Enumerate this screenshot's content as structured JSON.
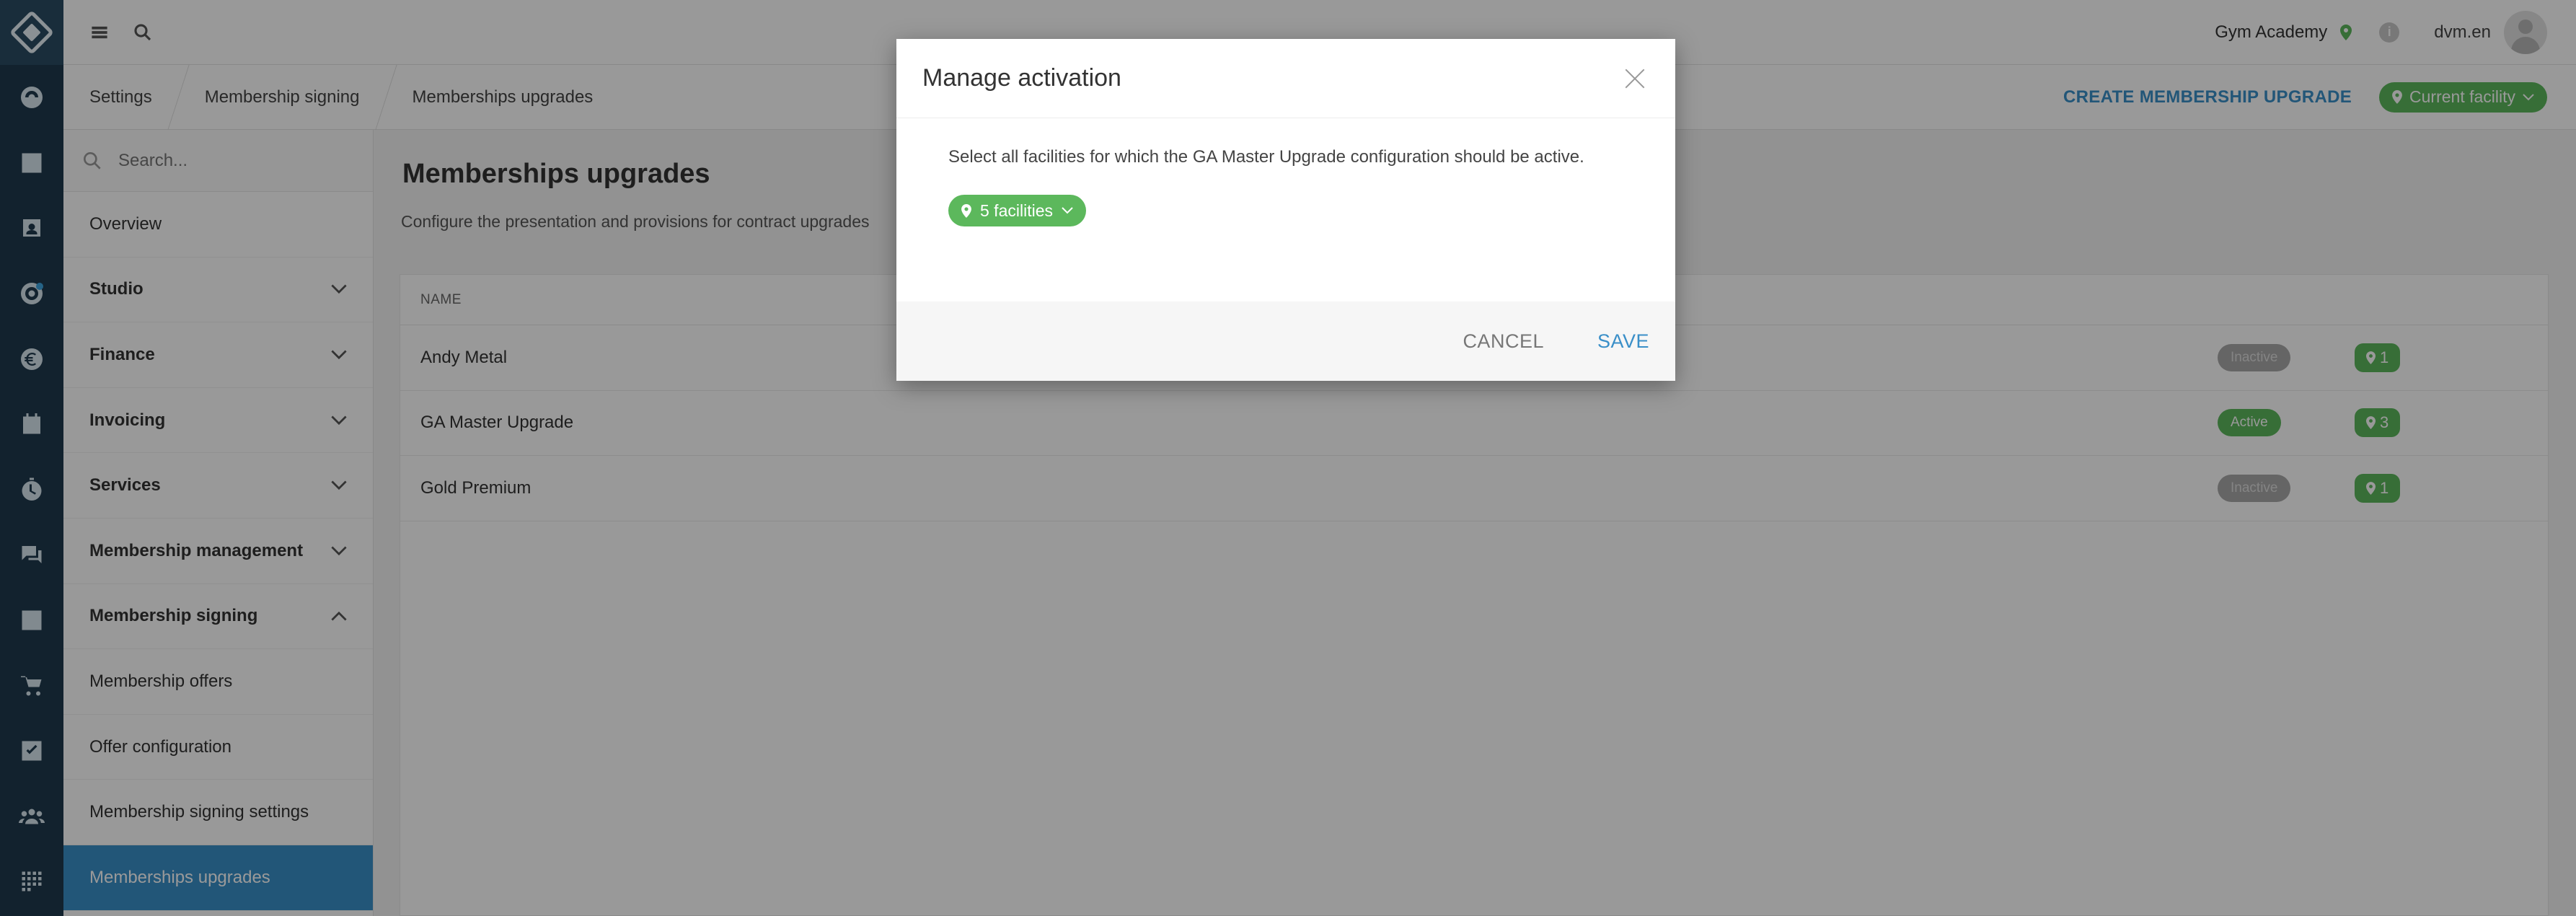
{
  "topbar": {
    "gym_name": "Gym Academy",
    "user_name": "dvm.en"
  },
  "breadcrumb": [
    "Settings",
    "Membership signing",
    "Memberships upgrades"
  ],
  "header_actions": {
    "create_label": "CREATE MEMBERSHIP UPGRADE",
    "facility_label": "Current facility"
  },
  "sidebar": {
    "search_placeholder": "Search...",
    "items": [
      {
        "label": "Overview",
        "section": false
      },
      {
        "label": "Studio",
        "section": true,
        "expanded": false
      },
      {
        "label": "Finance",
        "section": true,
        "expanded": false
      },
      {
        "label": "Invoicing",
        "section": true,
        "expanded": false
      },
      {
        "label": "Services",
        "section": true,
        "expanded": false
      },
      {
        "label": "Membership management",
        "section": true,
        "expanded": false
      },
      {
        "label": "Membership signing",
        "section": true,
        "expanded": true
      },
      {
        "label": "Membership offers",
        "section": false
      },
      {
        "label": "Offer configuration",
        "section": false
      },
      {
        "label": "Membership signing settings",
        "section": false
      },
      {
        "label": "Memberships upgrades",
        "section": false,
        "active": true
      }
    ]
  },
  "main": {
    "title": "Memberships upgrades",
    "subtitle": "Configure the presentation and provisions for contract upgrades",
    "table": {
      "header_name": "NAME",
      "rows": [
        {
          "name": "Andy Metal",
          "status": "Inactive",
          "facilities": "1"
        },
        {
          "name": "GA Master Upgrade",
          "status": "Active",
          "facilities": "3"
        },
        {
          "name": "Gold Premium",
          "status": "Inactive",
          "facilities": "1"
        }
      ]
    }
  },
  "modal": {
    "title": "Manage activation",
    "text": "Select all facilities for which the GA Master Upgrade configuration should be active.",
    "facilities_label": "5 facilities",
    "cancel_label": "CANCEL",
    "save_label": "SAVE"
  },
  "colors": {
    "accent": "#3a8fc8",
    "success": "#5cb85c",
    "rail": "#1f3a4d"
  }
}
